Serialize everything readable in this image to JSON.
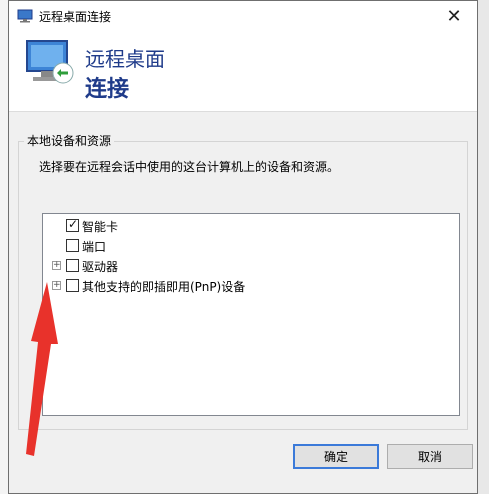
{
  "window": {
    "title": "远程桌面连接",
    "close_glyph": "✕"
  },
  "banner": {
    "line1": "远程桌面",
    "line2": "连接"
  },
  "group": {
    "title": "本地设备和资源",
    "description": "选择要在远程会话中使用的这台计算机上的设备和资源。"
  },
  "tree_items": [
    {
      "label": "智能卡",
      "checked": true,
      "expandable": false
    },
    {
      "label": "端口",
      "checked": false,
      "expandable": false
    },
    {
      "label": "驱动器",
      "checked": false,
      "expandable": true
    },
    {
      "label": "其他支持的即插即用(PnP)设备",
      "checked": false,
      "expandable": true
    }
  ],
  "buttons": {
    "ok": "确定",
    "cancel": "取消"
  },
  "annotation": {
    "arrow_color": "#e8322b"
  },
  "icons": {
    "title": "remote-desktop-icon",
    "banner": "remote-desktop-monitor-icon",
    "check": "✓",
    "expand": "+"
  }
}
